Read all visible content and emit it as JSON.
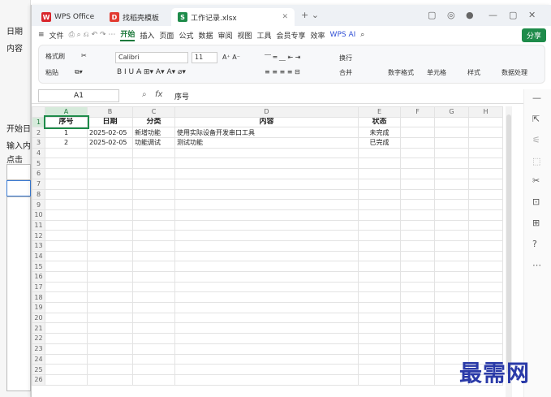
{
  "bg_app": {
    "items": [
      "日期",
      "内容",
      "开始日",
      "输入内",
      "点击"
    ]
  },
  "tabs": [
    {
      "label": "WPS Office",
      "color": "#d9262c",
      "icon": "W"
    },
    {
      "label": "找稻壳模板",
      "color": "#e23b31",
      "icon": "D"
    },
    {
      "label": "工作记录.xlsx",
      "color": "#1e8b4a",
      "icon": "S"
    }
  ],
  "menu": [
    "文件",
    "开始",
    "插入",
    "页面",
    "公式",
    "数据",
    "审阅",
    "视图",
    "工具",
    "会员专享",
    "效率",
    "WPS AI"
  ],
  "menu_active": "开始",
  "share_label": "分享",
  "ribbon": {
    "format_painter": "格式刷",
    "paste": "粘贴",
    "font": "Calibri",
    "size": "11",
    "wrap": "换行",
    "merge": "合并",
    "number_format": "数字格式",
    "cell": "单元格",
    "style": "样式",
    "data_proc": "数据处理"
  },
  "formula": {
    "cell": "A1",
    "fx": "fx",
    "value": "序号"
  },
  "columns": [
    "A",
    "B",
    "C",
    "D",
    "E",
    "F",
    "G",
    "H"
  ],
  "rows": [
    {
      "n": "1",
      "cells": [
        "序号",
        "日期",
        "分类",
        "内容",
        "状态",
        "",
        "",
        ""
      ]
    },
    {
      "n": "2",
      "cells": [
        "1",
        "2025-02-05",
        "新增功能",
        "使用实际设备开发串口工具",
        "未完成",
        "",
        "",
        ""
      ]
    },
    {
      "n": "3",
      "cells": [
        "2",
        "2025-02-05",
        "功能调试",
        "测试功能",
        "已完成",
        "",
        "",
        ""
      ]
    }
  ],
  "empty_rows": [
    "4",
    "5",
    "6",
    "7",
    "8",
    "9",
    "10",
    "11",
    "12",
    "13",
    "14",
    "15",
    "16",
    "17",
    "18",
    "19",
    "20",
    "21",
    "22",
    "23",
    "24",
    "25",
    "26"
  ],
  "watermark": "最需网"
}
